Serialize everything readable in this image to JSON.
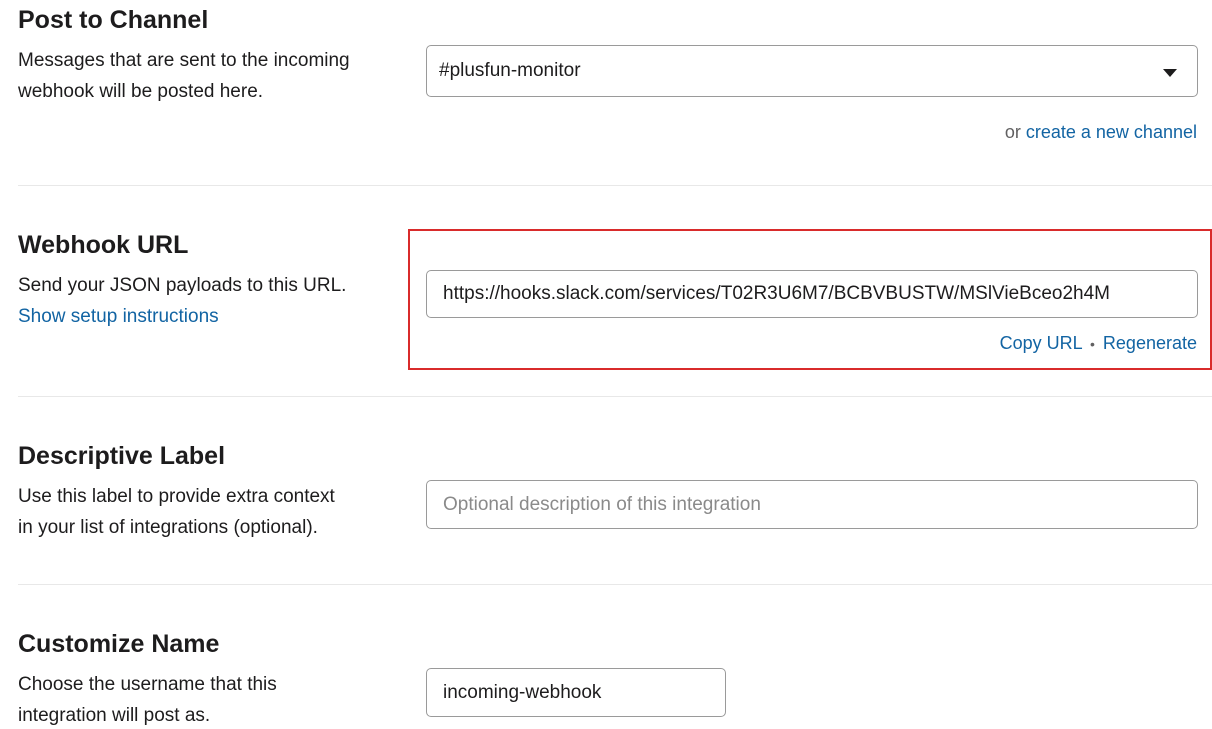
{
  "post_to_channel": {
    "title": "Post to Channel",
    "description_lines": [
      "Messages that are sent to the incoming",
      "webhook will be posted here."
    ],
    "selected_channel": "#plusfun-monitor",
    "or_text": "or",
    "create_channel_link": "create a new channel"
  },
  "webhook_url": {
    "title": "Webhook URL",
    "description": "Send your JSON payloads to this URL.",
    "setup_link": "Show setup instructions",
    "url": "https://hooks.slack.com/services/T02R3U6M7/BCBVBUSTW/MSlVieBceo2h4M",
    "copy_link": "Copy URL",
    "separator": "•",
    "regenerate_link": "Regenerate"
  },
  "descriptive_label": {
    "title": "Descriptive Label",
    "description_lines": [
      "Use this label to provide extra context",
      "in your list of integrations (optional)."
    ],
    "placeholder": "Optional description of this integration"
  },
  "customize_name": {
    "title": "Customize Name",
    "description_lines": [
      "Choose the username that this",
      "integration will post as."
    ],
    "value": "incoming-webhook"
  },
  "colors": {
    "link": "#1264a3",
    "highlight_border": "#d92b2b"
  }
}
